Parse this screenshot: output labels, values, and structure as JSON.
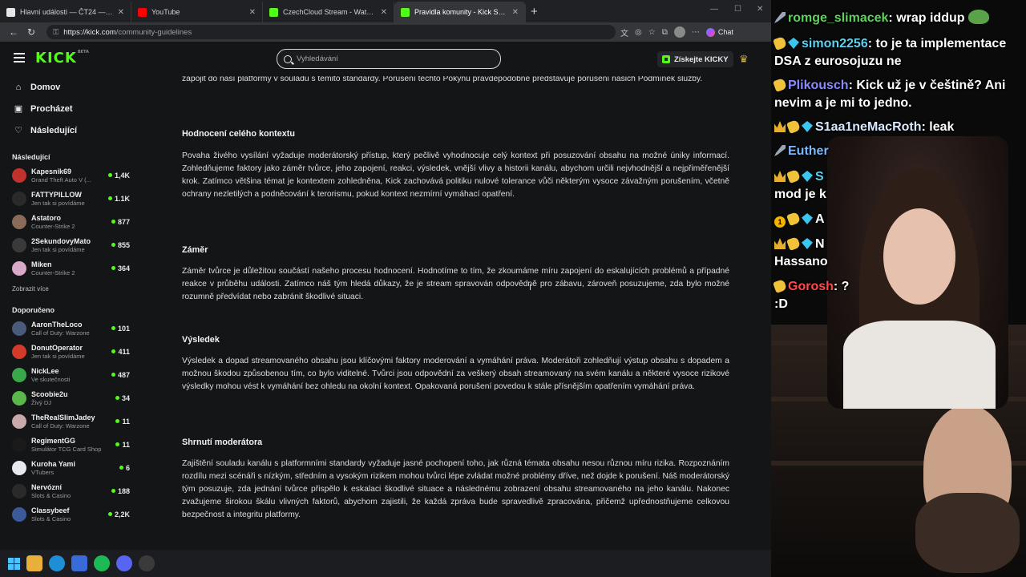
{
  "browser": {
    "tabs": [
      {
        "label": "Hlavní události — ČT24 — Česká t...",
        "color": "#e5e5e5",
        "active": false
      },
      {
        "label": "YouTube",
        "color": "#ff0000",
        "active": false
      },
      {
        "label": "CzechCloud Stream - Watch Live o...",
        "color": "#53fc18",
        "active": false
      },
      {
        "label": "Pravidla komunity - Kick Streaming...",
        "color": "#53fc18",
        "active": true
      }
    ],
    "url_host": "https://kick.com",
    "url_path": "/community-guidelines",
    "chat_label": "Chat"
  },
  "header": {
    "logo": "KICK",
    "logo_sup": "BETA",
    "search_placeholder": "Vyhledávání",
    "get_kicky": "Získejte KICKY"
  },
  "sidebar": {
    "nav": [
      {
        "label": "Domov",
        "icon": "home-icon",
        "glyph": "⌂"
      },
      {
        "label": "Procházet",
        "icon": "browse-icon",
        "glyph": "▣"
      },
      {
        "label": "Následující",
        "icon": "heart-icon",
        "glyph": "♡"
      }
    ],
    "following_title": "Následující",
    "following": [
      {
        "name": "Kapesnik69",
        "category": "Grand Theft Auto V (...",
        "viewers": "1,4K",
        "avatar": "#c0322b"
      },
      {
        "name": "FATTYPILLOW",
        "category": "Jen tak si povídáme",
        "viewers": "1.1K",
        "avatar": "#2a2a2a"
      },
      {
        "name": "Astatoro",
        "category": "Counter-Strike 2",
        "viewers": "877",
        "avatar": "#8a6b5a"
      },
      {
        "name": "2SekundovyMato",
        "category": "Jen tak si povídáme",
        "viewers": "855",
        "avatar": "#3a3a3a"
      },
      {
        "name": "Miken",
        "category": "Counter-Strike 2",
        "viewers": "364",
        "avatar": "#d9a9c9"
      }
    ],
    "show_more": "Zobrazit více",
    "recommended_title": "Doporučeno",
    "recommended": [
      {
        "name": "AaronTheLoco",
        "category": "Call of Duty: Warzone",
        "viewers": "101",
        "avatar": "#4a5a7a"
      },
      {
        "name": "DonutOperator",
        "category": "Jen tak si povídáme",
        "viewers": "411",
        "avatar": "#d23a2a"
      },
      {
        "name": "NickLee",
        "category": "Ve skutečnosti",
        "viewers": "487",
        "avatar": "#3aa84a"
      },
      {
        "name": "Scoobie2u",
        "category": "Živý DJ",
        "viewers": "34",
        "avatar": "#5ab84a"
      },
      {
        "name": "TheRealSlimJadey",
        "category": "Call of Duty: Warzone",
        "viewers": "11",
        "avatar": "#c8a8a8"
      },
      {
        "name": "RegimentGG",
        "category": "Simulátor TCG Card Shop",
        "viewers": "11",
        "avatar": "#1a1a1a"
      },
      {
        "name": "Kuroha Yami",
        "category": "VTubers",
        "viewers": "6",
        "avatar": "#e8e8f0"
      },
      {
        "name": "Nervózní",
        "category": "Slots & Casino",
        "viewers": "188",
        "avatar": "#2a2a2a"
      },
      {
        "name": "Classybeef",
        "category": "Slots & Casino",
        "viewers": "2,2K",
        "avatar": "#3a5a9a"
      }
    ]
  },
  "content": {
    "intro": "zapojit do naší platformy v souladu s těmito standardy. Porušení těchto Pokynů pravděpodobně představuje porušení našich Podmínek služby.",
    "sections": [
      {
        "heading": "Hodnocení celého kontextu",
        "body": "Povaha živého vysílání vyžaduje moderátorský přístup, který pečlivě vyhodnocuje celý kontext při posuzování obsahu na možné úniky informací. Zohledňujeme faktory jako záměr tvůrce, jeho zapojení, reakci, výsledek, vnější vlivy a historii kanálu, abychom určili nejvhodnější a nejpřiměřenější krok. Zatímco většina témat je kontextem zohledněna, Kick zachovává politiku nulové tolerance vůči některým vysoce závažným porušením, včetně ochrany nezletilých a podněcování k terorismu, pokud kontext nezmírní vymáhací opatření."
      },
      {
        "heading": "Záměr",
        "body": "Záměr tvůrce je důležitou součástí našeho procesu hodnocení. Hodnotíme to tím, že zkoumáme míru zapojení do eskalujících problémů a případné reakce v průběhu události. Zatímco náš tým hledá důkazy, že je stream spravován odpovědně pro zábavu, zároveň posuzujeme, zda bylo možné rozumně předvídat nebo zabránit škodlivé situaci."
      },
      {
        "heading": "Výsledek",
        "body": "Výsledek a dopad streamovaného obsahu jsou klíčovými faktory moderování a vymáhání práva. Moderátoři zohledňují výstup obsahu s dopadem a možnou škodou způsobenou tím, co bylo viditelné. Tvůrci jsou odpovědní za veškerý obsah streamovaný na svém kanálu a některé vysoce rizikové výsledky mohou vést k vymáhání bez ohledu na okolní kontext. Opakovaná porušení povedou k stále přísnějším opatřením vymáhání práva."
      },
      {
        "heading": "Shrnutí moderátora",
        "body": "Zajištění souladu kanálu s platformními standardy vyžaduje jasné pochopení toho, jak různá témata obsahu nesou různou míru rizika. Rozpoznáním rozdílu mezi scénáři s nízkým, středním a vysokým rizikem mohou tvůrci lépe zvládat možné problémy dříve, než dojde k porušení. Náš moderátorský tým posuzuje, zda jednání tvůrce přispělo k eskalaci škodlivé situace a následnému zobrazení obsahu streamovaného na jeho kanálu. Nakonec zvažujeme širokou škálu vlivných faktorů, abychom zajistili, že každá zpráva bude spravedlivě zpracována, přičemž upřednostňujeme celkovou bezpečnost a integritu platformy."
      }
    ]
  },
  "chat": [
    {
      "badges": [
        "sword"
      ],
      "user": "romge_slimacek",
      "user_color": "#5fd35f",
      "text": "wrap iddup",
      "emote": true
    },
    {
      "badges": [
        "hand",
        "gem"
      ],
      "user": "simon2256",
      "user_color": "#5fd0f0",
      "text": "to je ta implementace",
      "cont": "DSA z eurosojuzu ne"
    },
    {
      "badges": [
        "hand"
      ],
      "user": "Plikousch",
      "user_color": "#8a8aff",
      "text": "Kick už je v češtině? Ani",
      "cont": "nevim a je mi to jedno."
    },
    {
      "badges": [
        "crown",
        "hand",
        "gem"
      ],
      "user": "S1aa1neMacRoth",
      "user_color": "#d8e8ff",
      "text": "leak"
    },
    {
      "badges": [
        "sword"
      ],
      "user": "Euther",
      "user_color": "#7ab8ff",
      "text": ""
    },
    {
      "badges": [
        "crown",
        "hand",
        "gem"
      ],
      "user": "S",
      "user_color": "#5fd0f0",
      "text": "",
      "cont": "mod je k"
    },
    {
      "badges": [
        "num",
        "hand",
        "gem"
      ],
      "user": "A",
      "user_color": "#ffffff",
      "text": ""
    },
    {
      "badges": [
        "crown",
        "hand",
        "gem"
      ],
      "user": "N",
      "user_color": "#ffffff",
      "text": "",
      "cont": "Hassano"
    },
    {
      "badges": [
        "hand"
      ],
      "user": "Gorosh",
      "user_color": "#ff4a4a",
      "text": "?",
      "cont": ":D"
    }
  ]
}
